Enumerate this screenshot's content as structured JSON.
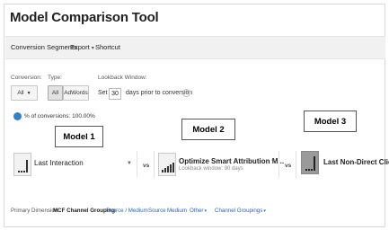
{
  "title": "Model Comparison Tool",
  "toolbar": {
    "conversion_segments": "Conversion Segments",
    "export": "Export",
    "shortcut": "Shortcut"
  },
  "filters": {
    "conversion_label": "Conversion:",
    "conversion_value": "All",
    "type_label": "Type:",
    "type_options": [
      "All",
      "AdWords"
    ],
    "lookback_label": "Lookback Window:",
    "set_label": "Set",
    "days_value": "30",
    "days_suffix": "days prior to conversion",
    "help_glyph": "?"
  },
  "summary": {
    "percent_label": "% of conversions: 100.00%"
  },
  "callouts": [
    "Model 1",
    "Model 2",
    "Model 3"
  ],
  "models": [
    {
      "name": "Last Interaction",
      "icon": "bar-chart-last-icon"
    },
    {
      "name": "Optimize Smart Attribution M...",
      "subtitle": "Lookback window: 90 days",
      "icon": "bar-chart-rising-icon"
    },
    {
      "name": "Last Non-Direct Click",
      "icon": "bar-chart-last-icon"
    }
  ],
  "vs_label": "vs",
  "dropdown_glyph": "▼",
  "dimensions": {
    "label": "Primary Dimension:",
    "items": [
      "MCF Channel Grouping",
      "Source / Medium",
      "Source",
      "Medium",
      "Other",
      "Channel Groupings"
    ]
  }
}
